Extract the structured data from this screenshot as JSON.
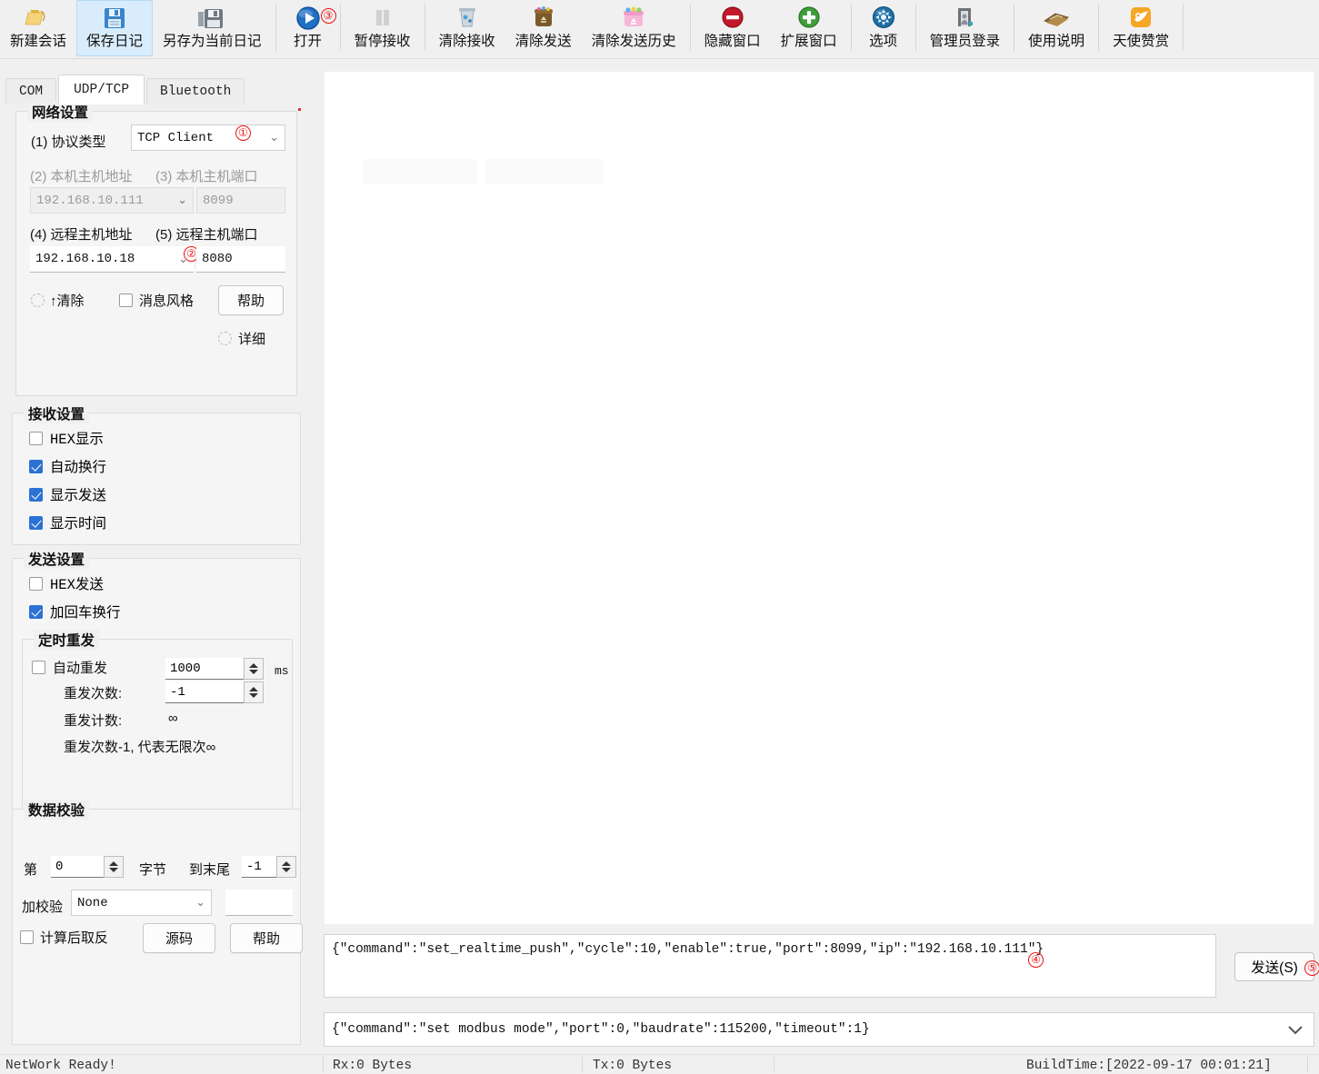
{
  "toolbar": {
    "items": [
      {
        "label": "新建会话",
        "icon": "new-session-folder-icon",
        "active": false
      },
      {
        "label": "保存日记",
        "icon": "save-floppy-icon",
        "active": true
      },
      {
        "label": "另存为当前日记",
        "icon": "save-as-floppy-icon",
        "active": false
      },
      {
        "label": "打开",
        "icon": "open-play-icon",
        "active": false,
        "badge": "③"
      },
      {
        "label": "暂停接收",
        "icon": "pause-icon",
        "active": false
      },
      {
        "label": "清除接收",
        "icon": "clear-recv-trash-icon",
        "active": false
      },
      {
        "label": "清除发送",
        "icon": "clear-send-bin-icon",
        "active": false
      },
      {
        "label": "清除发送历史",
        "icon": "clear-send-history-basket-icon",
        "active": false
      },
      {
        "label": "隐藏窗口",
        "icon": "hide-window-minus-icon",
        "active": false
      },
      {
        "label": "扩展窗口",
        "icon": "expand-window-plus-icon",
        "active": false
      },
      {
        "label": "选项",
        "icon": "options-gear-globe-icon",
        "active": false
      },
      {
        "label": "管理员登录",
        "icon": "admin-login-door-icon",
        "active": false
      },
      {
        "label": "使用说明",
        "icon": "help-book-icon",
        "active": false
      },
      {
        "label": "天使赞赏",
        "icon": "donate-angel-icon",
        "active": false
      }
    ]
  },
  "tabs": [
    {
      "label": "COM",
      "active": false
    },
    {
      "label": "UDP/TCP",
      "active": true
    },
    {
      "label": "Bluetooth",
      "active": false
    }
  ],
  "network": {
    "title": "网络设置",
    "protocol_label": "(1) 协议类型",
    "protocol_value": "TCP Client",
    "protocol_badge": "①",
    "local_addr_label": "(2) 本机主机地址",
    "local_port_label": "(3) 本机主机端口",
    "local_addr_value": "192.168.10.111",
    "local_port_value": "8099",
    "remote_addr_label": "(4) 远程主机地址",
    "remote_port_label": "(5) 远程主机端口",
    "remote_addr_value": "192.168.10.18",
    "remote_addr_badge": "②",
    "remote_port_value": "8080",
    "clear_label": "↑清除",
    "msg_style_label": "消息风格",
    "help_label": "帮助",
    "detail_label": "详细"
  },
  "receive_settings": {
    "title": "接收设置",
    "options": [
      {
        "label": "HEX显示",
        "checked": false,
        "mono": true
      },
      {
        "label": "自动换行",
        "checked": true,
        "mono": false
      },
      {
        "label": "显示发送",
        "checked": true,
        "mono": false
      },
      {
        "label": "显示时间",
        "checked": true,
        "mono": false
      }
    ]
  },
  "send_settings": {
    "title": "发送设置",
    "options": [
      {
        "label": "HEX发送",
        "checked": false,
        "mono": true
      },
      {
        "label": "加回车换行",
        "checked": true,
        "mono": false
      }
    ],
    "timer": {
      "title": "定时重发",
      "auto_label": "自动重发",
      "auto_checked": false,
      "interval_value": "1000",
      "interval_unit": "ms",
      "count_label": "重发次数:",
      "count_value": "-1",
      "counter_label": "重发计数:",
      "counter_value": "∞",
      "note": "重发次数-1, 代表无限次∞"
    }
  },
  "data_check": {
    "title": "数据校验",
    "from_label": "第",
    "from_value": "0",
    "byte_label": "字节",
    "to_label": "到末尾",
    "to_value": "-1",
    "checksum_label": "加校验",
    "checksum_value": "None",
    "result_value": "",
    "invert_label": "计算后取反",
    "invert_checked": false,
    "source_label": "源码",
    "help_label": "帮助"
  },
  "send_area": {
    "text": "{\"command\":\"set_realtime_push\",\"cycle\":10,\"enable\":true,\"port\":8099,\"ip\":\"192.168.10.111\"}",
    "badge": "④",
    "send_button": "发送(S)",
    "send_button_badge": "⑤"
  },
  "history": {
    "text": "{\"command\":\"set modbus mode\",\"port\":0,\"baudrate\":115200,\"timeout\":1}"
  },
  "status": {
    "net_label": "NetWork Ready!",
    "rx_label": "Rx:0 Bytes",
    "tx_label": "Tx:0 Bytes",
    "build_label": "BuildTime:[2022-09-17 00:01:21]"
  },
  "colors": {
    "accent": "#2b72d4",
    "badge_red": "#ee1111",
    "toolbar_active": "#d9ecfb",
    "panel_bg": "#f0f0f0"
  }
}
